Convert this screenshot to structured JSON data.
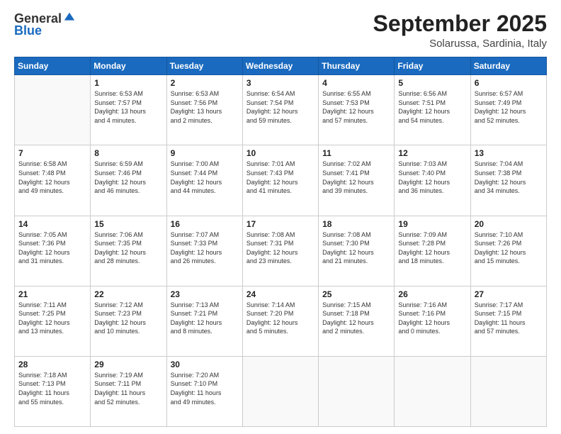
{
  "header": {
    "logo_general": "General",
    "logo_blue": "Blue",
    "month": "September 2025",
    "location": "Solarussa, Sardinia, Italy"
  },
  "weekdays": [
    "Sunday",
    "Monday",
    "Tuesday",
    "Wednesday",
    "Thursday",
    "Friday",
    "Saturday"
  ],
  "weeks": [
    [
      {
        "day": "",
        "info": ""
      },
      {
        "day": "1",
        "info": "Sunrise: 6:53 AM\nSunset: 7:57 PM\nDaylight: 13 hours\nand 4 minutes."
      },
      {
        "day": "2",
        "info": "Sunrise: 6:53 AM\nSunset: 7:56 PM\nDaylight: 13 hours\nand 2 minutes."
      },
      {
        "day": "3",
        "info": "Sunrise: 6:54 AM\nSunset: 7:54 PM\nDaylight: 12 hours\nand 59 minutes."
      },
      {
        "day": "4",
        "info": "Sunrise: 6:55 AM\nSunset: 7:53 PM\nDaylight: 12 hours\nand 57 minutes."
      },
      {
        "day": "5",
        "info": "Sunrise: 6:56 AM\nSunset: 7:51 PM\nDaylight: 12 hours\nand 54 minutes."
      },
      {
        "day": "6",
        "info": "Sunrise: 6:57 AM\nSunset: 7:49 PM\nDaylight: 12 hours\nand 52 minutes."
      }
    ],
    [
      {
        "day": "7",
        "info": "Sunrise: 6:58 AM\nSunset: 7:48 PM\nDaylight: 12 hours\nand 49 minutes."
      },
      {
        "day": "8",
        "info": "Sunrise: 6:59 AM\nSunset: 7:46 PM\nDaylight: 12 hours\nand 46 minutes."
      },
      {
        "day": "9",
        "info": "Sunrise: 7:00 AM\nSunset: 7:44 PM\nDaylight: 12 hours\nand 44 minutes."
      },
      {
        "day": "10",
        "info": "Sunrise: 7:01 AM\nSunset: 7:43 PM\nDaylight: 12 hours\nand 41 minutes."
      },
      {
        "day": "11",
        "info": "Sunrise: 7:02 AM\nSunset: 7:41 PM\nDaylight: 12 hours\nand 39 minutes."
      },
      {
        "day": "12",
        "info": "Sunrise: 7:03 AM\nSunset: 7:40 PM\nDaylight: 12 hours\nand 36 minutes."
      },
      {
        "day": "13",
        "info": "Sunrise: 7:04 AM\nSunset: 7:38 PM\nDaylight: 12 hours\nand 34 minutes."
      }
    ],
    [
      {
        "day": "14",
        "info": "Sunrise: 7:05 AM\nSunset: 7:36 PM\nDaylight: 12 hours\nand 31 minutes."
      },
      {
        "day": "15",
        "info": "Sunrise: 7:06 AM\nSunset: 7:35 PM\nDaylight: 12 hours\nand 28 minutes."
      },
      {
        "day": "16",
        "info": "Sunrise: 7:07 AM\nSunset: 7:33 PM\nDaylight: 12 hours\nand 26 minutes."
      },
      {
        "day": "17",
        "info": "Sunrise: 7:08 AM\nSunset: 7:31 PM\nDaylight: 12 hours\nand 23 minutes."
      },
      {
        "day": "18",
        "info": "Sunrise: 7:08 AM\nSunset: 7:30 PM\nDaylight: 12 hours\nand 21 minutes."
      },
      {
        "day": "19",
        "info": "Sunrise: 7:09 AM\nSunset: 7:28 PM\nDaylight: 12 hours\nand 18 minutes."
      },
      {
        "day": "20",
        "info": "Sunrise: 7:10 AM\nSunset: 7:26 PM\nDaylight: 12 hours\nand 15 minutes."
      }
    ],
    [
      {
        "day": "21",
        "info": "Sunrise: 7:11 AM\nSunset: 7:25 PM\nDaylight: 12 hours\nand 13 minutes."
      },
      {
        "day": "22",
        "info": "Sunrise: 7:12 AM\nSunset: 7:23 PM\nDaylight: 12 hours\nand 10 minutes."
      },
      {
        "day": "23",
        "info": "Sunrise: 7:13 AM\nSunset: 7:21 PM\nDaylight: 12 hours\nand 8 minutes."
      },
      {
        "day": "24",
        "info": "Sunrise: 7:14 AM\nSunset: 7:20 PM\nDaylight: 12 hours\nand 5 minutes."
      },
      {
        "day": "25",
        "info": "Sunrise: 7:15 AM\nSunset: 7:18 PM\nDaylight: 12 hours\nand 2 minutes."
      },
      {
        "day": "26",
        "info": "Sunrise: 7:16 AM\nSunset: 7:16 PM\nDaylight: 12 hours\nand 0 minutes."
      },
      {
        "day": "27",
        "info": "Sunrise: 7:17 AM\nSunset: 7:15 PM\nDaylight: 11 hours\nand 57 minutes."
      }
    ],
    [
      {
        "day": "28",
        "info": "Sunrise: 7:18 AM\nSunset: 7:13 PM\nDaylight: 11 hours\nand 55 minutes."
      },
      {
        "day": "29",
        "info": "Sunrise: 7:19 AM\nSunset: 7:11 PM\nDaylight: 11 hours\nand 52 minutes."
      },
      {
        "day": "30",
        "info": "Sunrise: 7:20 AM\nSunset: 7:10 PM\nDaylight: 11 hours\nand 49 minutes."
      },
      {
        "day": "",
        "info": ""
      },
      {
        "day": "",
        "info": ""
      },
      {
        "day": "",
        "info": ""
      },
      {
        "day": "",
        "info": ""
      }
    ]
  ]
}
